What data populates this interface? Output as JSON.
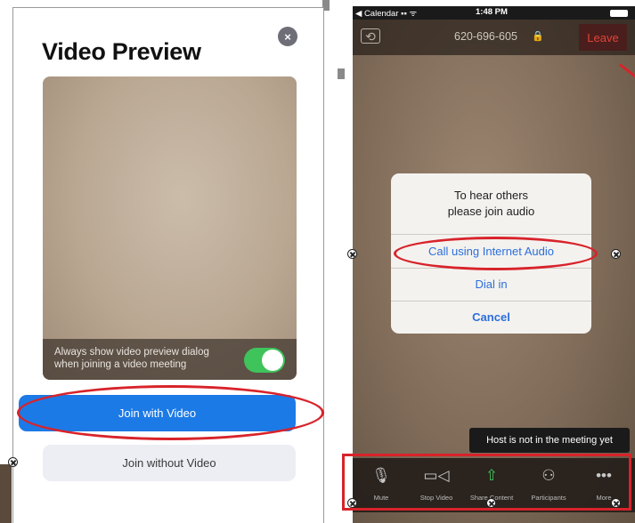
{
  "video_preview": {
    "title": "Video Preview",
    "close_glyph": "×",
    "preview_option_text": "Always show video preview dialog when joining a video meeting",
    "preview_option_enabled": true,
    "join_with_video_label": "Join with Video",
    "join_without_video_label": "Join without Video",
    "toggle_on_color": "#3fc35b",
    "primary_button_color": "#1c7ae6"
  },
  "phone": {
    "status_bar": {
      "carrier": "◀ Calendar",
      "signal": "▪▪ ᯤ",
      "time": "1:48 PM"
    },
    "meeting_bar": {
      "meeting_id": "620-696-605",
      "leave_label": "Leave",
      "leave_color": "#e0433a"
    },
    "audio_dialog": {
      "title_line1": "To hear others",
      "title_line2": "please join audio",
      "options": [
        "Call using Internet Audio",
        "Dial in"
      ],
      "cancel_label": "Cancel",
      "link_color": "#2b6fdb"
    },
    "host_tooltip": "Host is not in the meeting yet",
    "toolbar": {
      "items": [
        {
          "label": "Mute",
          "icon": "microphone-icon",
          "glyph": "🎙"
        },
        {
          "label": "Stop Video",
          "icon": "video-camera-icon",
          "glyph": "▭◁"
        },
        {
          "label": "Share Content",
          "icon": "share-icon",
          "glyph": "⇧"
        },
        {
          "label": "Participants",
          "icon": "participants-icon",
          "glyph": "⚇"
        },
        {
          "label": "More",
          "icon": "more-icon",
          "glyph": "•••"
        }
      ]
    }
  },
  "annotations": {
    "highlight_color": "#d8232a"
  }
}
